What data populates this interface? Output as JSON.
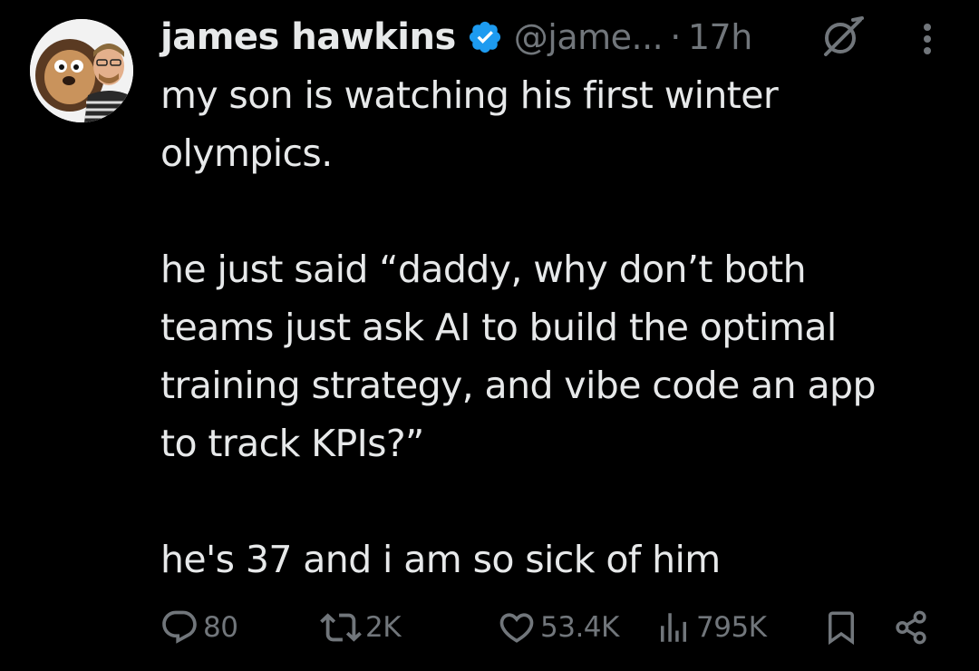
{
  "tweet": {
    "author": {
      "display_name": "james hawkins",
      "handle": "@jame...",
      "verified": true,
      "avatar": "avatar-photo"
    },
    "separator": "·",
    "timestamp": "17h",
    "icons": {
      "grok": "grok-icon",
      "more": "more-icon"
    },
    "text": {
      "paragraph_1": "my son is watching his first winter\nolympics.",
      "paragraph_2": "he just said “daddy, why don’t both\nteams just ask AI to build the optimal\ntraining strategy, and vibe code an app\nto track KPIs?”",
      "paragraph_3": "he's 37 and i am so sick of him"
    },
    "actions": {
      "replies": "80",
      "reposts": "2K",
      "likes": "53.4K",
      "views": "795K"
    },
    "colors": {
      "background": "#000000",
      "text": "#e7e9ea",
      "muted": "#71767b",
      "verified_badge": "#1d9bf0"
    }
  }
}
